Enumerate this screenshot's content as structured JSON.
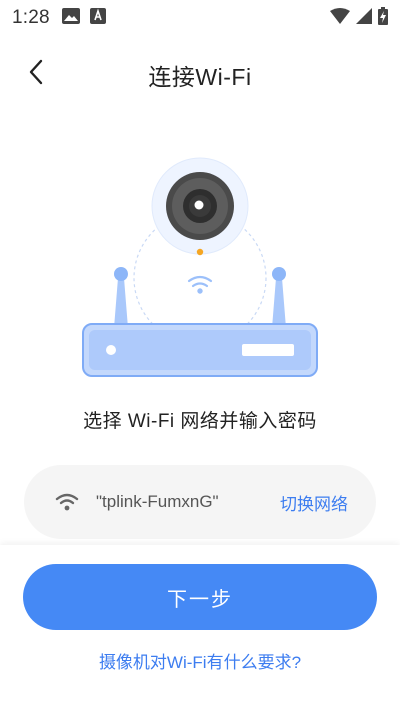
{
  "status_bar": {
    "time": "1:28",
    "left_icons": [
      "image-icon",
      "text-app-icon"
    ],
    "right_icons": [
      "wifi-signal-icon",
      "cell-signal-icon",
      "battery-charging-icon"
    ]
  },
  "header": {
    "title": "连接Wi-Fi",
    "back_icon": "chevron-left-icon"
  },
  "instruction": "选择 Wi-Fi 网络并输入密码",
  "network": {
    "icon": "wifi-icon",
    "name": "\"tplink-FumxnG\"",
    "switch_label": "切换网络"
  },
  "actions": {
    "next_label": "下一步",
    "help_link": "摄像机对Wi-Fi有什么要求?"
  },
  "colors": {
    "accent": "#4589f5",
    "link": "#3d7df0",
    "router": "#a9c8fb",
    "router_dark": "#7fabf6"
  }
}
